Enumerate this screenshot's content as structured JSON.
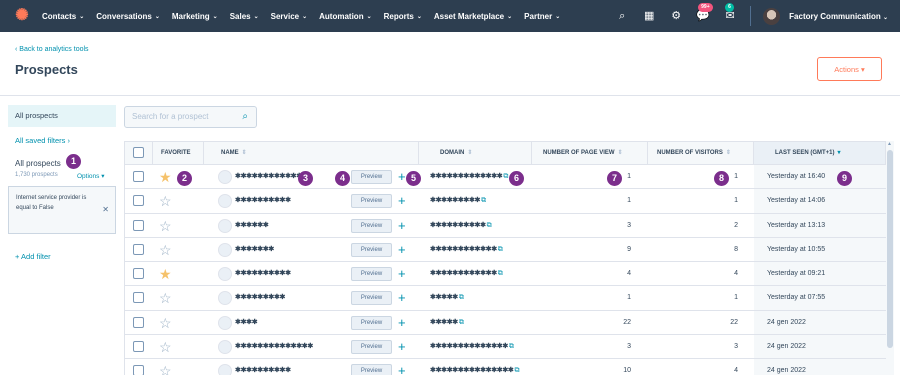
{
  "nav": {
    "items": [
      "Contacts",
      "Conversations",
      "Marketing",
      "Sales",
      "Service",
      "Automation",
      "Reports",
      "Asset Marketplace",
      "Partner"
    ],
    "notification_badge": "99+",
    "chat_badge": "6",
    "company": "Factory Communication"
  },
  "header": {
    "back_link": "‹ Back to analytics tools",
    "title": "Prospects",
    "actions": "Actions ▾"
  },
  "sidebar": {
    "active": "All prospects",
    "saved_filters": "All saved filters ›",
    "list_title": "All prospects",
    "count": "1,730 prospects",
    "options": "Options ▾",
    "filter_text": "Internet service provider is equal to False",
    "add_filter": "+ Add filter"
  },
  "search": {
    "placeholder": "Search for a prospect"
  },
  "table": {
    "headers": {
      "favorite": "FAVORITE",
      "name": "NAME",
      "domain": "DOMAIN",
      "page_views": "NUMBER OF PAGE VIEW",
      "visitors": "NUMBER OF VISITORS",
      "last_seen": "LAST SEEN (GMT+1)"
    },
    "preview_label": "Preview",
    "rows": [
      {
        "fav": true,
        "name": "✱✱✱✱✱✱✱✱✱✱✱✱✱",
        "domain": "✱✱✱✱✱✱✱✱✱✱✱✱✱",
        "page_views": "1",
        "visitors": "1",
        "last_seen": "Yesterday at 16:40"
      },
      {
        "fav": false,
        "name": "✱✱✱✱✱✱✱✱✱✱",
        "domain": "✱✱✱✱✱✱✱✱✱",
        "page_views": "1",
        "visitors": "1",
        "last_seen": "Yesterday at 14:06"
      },
      {
        "fav": false,
        "name": "✱✱✱✱✱✱",
        "domain": "✱✱✱✱✱✱✱✱✱✱",
        "page_views": "3",
        "visitors": "2",
        "last_seen": "Yesterday at 13:13"
      },
      {
        "fav": false,
        "name": "✱✱✱✱✱✱✱",
        "domain": "✱✱✱✱✱✱✱✱✱✱✱✱",
        "page_views": "9",
        "visitors": "8",
        "last_seen": "Yesterday at 10:55"
      },
      {
        "fav": true,
        "name": "✱✱✱✱✱✱✱✱✱✱",
        "domain": "✱✱✱✱✱✱✱✱✱✱✱✱",
        "page_views": "4",
        "visitors": "4",
        "last_seen": "Yesterday at 09:21"
      },
      {
        "fav": false,
        "name": "✱✱✱✱✱✱✱✱✱",
        "domain": "✱✱✱✱✱",
        "page_views": "1",
        "visitors": "1",
        "last_seen": "Yesterday at 07:55"
      },
      {
        "fav": false,
        "name": "✱✱✱✱",
        "domain": "✱✱✱✱✱",
        "page_views": "22",
        "visitors": "22",
        "last_seen": "24 gen 2022"
      },
      {
        "fav": false,
        "name": "✱✱✱✱✱✱✱✱✱✱✱✱✱✱",
        "domain": "✱✱✱✱✱✱✱✱✱✱✱✱✱✱",
        "page_views": "3",
        "visitors": "3",
        "last_seen": "24 gen 2022"
      },
      {
        "fav": false,
        "name": "✱✱✱✱✱✱✱✱✱✱",
        "domain": "✱✱✱✱✱✱✱✱✱✱✱✱✱✱✱",
        "page_views": "10",
        "visitors": "4",
        "last_seen": "24 gen 2022"
      }
    ]
  },
  "markers": [
    "1",
    "2",
    "3",
    "4",
    "5",
    "6",
    "7",
    "8",
    "9"
  ]
}
